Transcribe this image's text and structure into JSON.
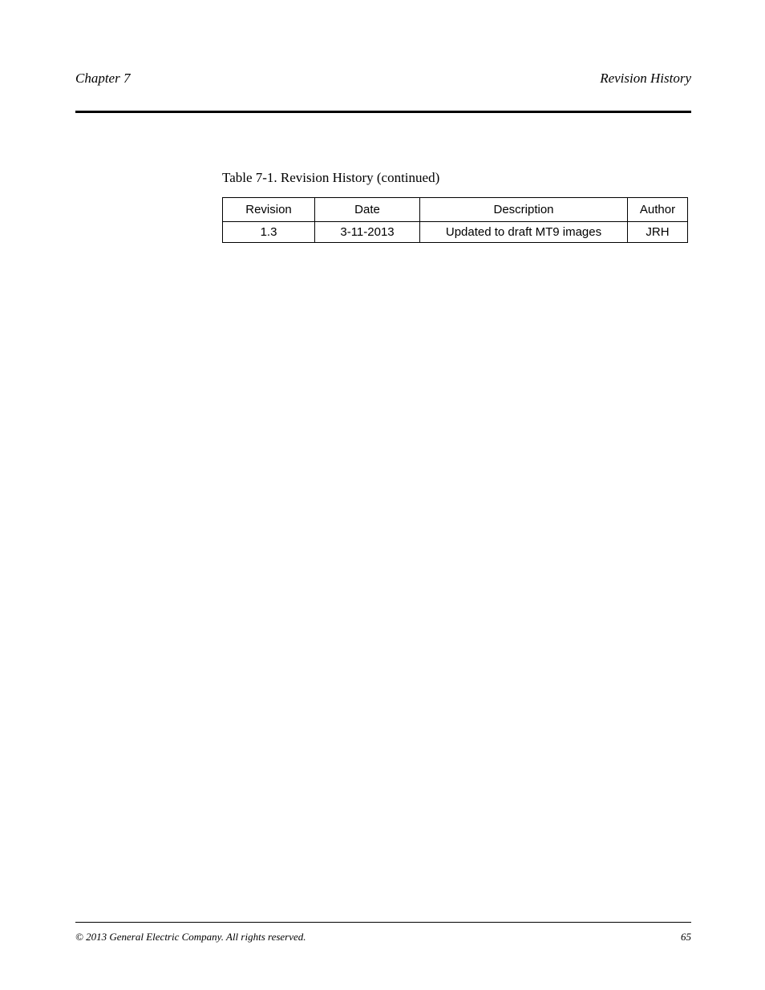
{
  "header": {
    "left": "Chapter 7",
    "right": "Revision History"
  },
  "table": {
    "caption": "Table 7-1. Revision History (continued)",
    "headers": [
      "Revision",
      "Date",
      "Description",
      "Author"
    ],
    "rows": [
      [
        "1.3",
        "3-11-2013",
        "Updated to draft MT9 images",
        "JRH"
      ]
    ]
  },
  "footer": {
    "left": "© 2013 General Electric Company. All rights reserved.",
    "right": "65"
  }
}
